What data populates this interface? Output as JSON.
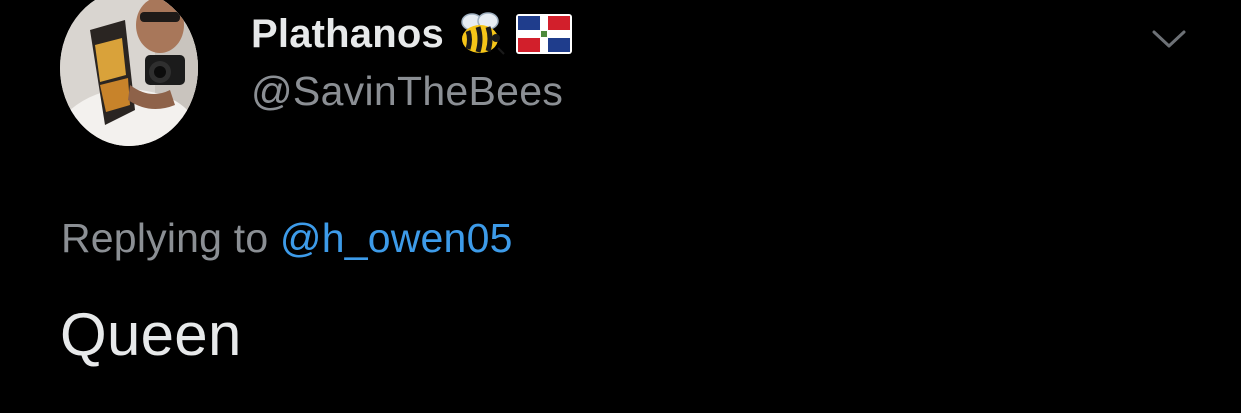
{
  "tweet": {
    "author": {
      "display_name": "Plathanos",
      "handle": "@SavinTheBees",
      "badges": [
        "bee-emoji",
        "dominican-republic-flag-emoji"
      ],
      "avatar": "profile-photo"
    },
    "menu_icon": "chevron-down-icon",
    "reply": {
      "prefix": "Replying to",
      "mention": "@h_owen05"
    },
    "text": "Queen"
  },
  "colors": {
    "background": "#000000",
    "primary_text": "#e7e9ea",
    "secondary_text": "#8b8f94",
    "link": "#3d9be9"
  }
}
